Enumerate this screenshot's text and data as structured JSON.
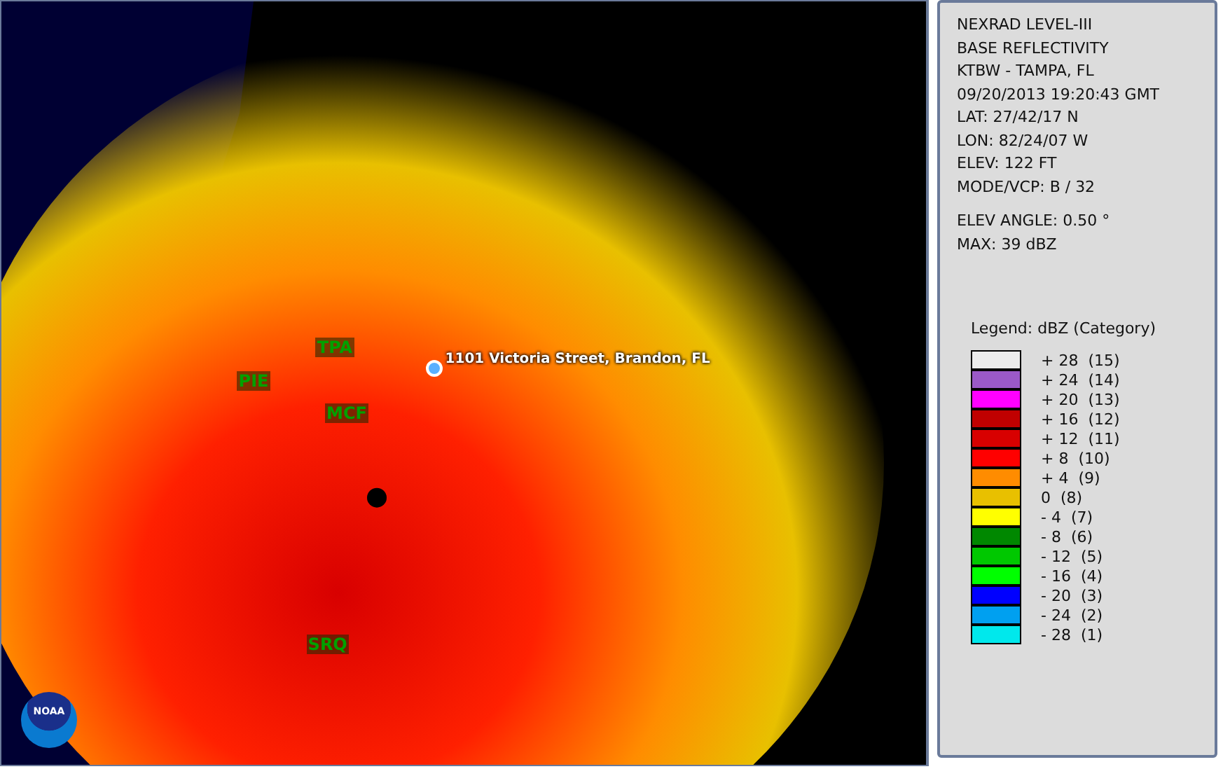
{
  "map": {
    "logo_text": "NOAA",
    "labels": [
      {
        "kind": "station",
        "text": "TPA"
      },
      {
        "kind": "station",
        "text": "PIE"
      },
      {
        "kind": "station",
        "text": "MCF"
      },
      {
        "kind": "station",
        "text": "SRQ"
      },
      {
        "kind": "address",
        "text": "1101 Victoria Street, Brandon, FL"
      }
    ]
  },
  "info": {
    "lines": [
      "NEXRAD LEVEL-III",
      "BASE REFLECTIVITY",
      "KTBW - TAMPA, FL",
      "09/20/2013 19:20:43 GMT",
      "LAT: 27/42/17 N",
      "LON: 82/24/07 W",
      "ELEV: 122 FT",
      "MODE/VCP: B / 32"
    ],
    "extra_lines": [
      "ELEV ANGLE: 0.50 °",
      "MAX: 39 dBZ"
    ]
  },
  "legend": {
    "title": "Legend: dBZ (Category)",
    "items": [
      {
        "label": "+ 28  (15)",
        "color": "#ececec"
      },
      {
        "label": "+ 24  (14)",
        "color": "#9b59c8"
      },
      {
        "label": "+ 20  (13)",
        "color": "#ff00ff"
      },
      {
        "label": "+ 16  (12)",
        "color": "#c00000"
      },
      {
        "label": "+ 12  (11)",
        "color": "#d80000"
      },
      {
        "label": "+ 8  (10)",
        "color": "#ff0000"
      },
      {
        "label": "+ 4  (9)",
        "color": "#ff8c00"
      },
      {
        "label": "0  (8)",
        "color": "#e8c000"
      },
      {
        "label": "- 4  (7)",
        "color": "#ffff00"
      },
      {
        "label": "- 8  (6)",
        "color": "#008800"
      },
      {
        "label": "- 12  (5)",
        "color": "#00c800"
      },
      {
        "label": "- 16  (4)",
        "color": "#00ff00"
      },
      {
        "label": "- 20  (3)",
        "color": "#0000ff"
      },
      {
        "label": "- 24  (2)",
        "color": "#00a0f0"
      },
      {
        "label": "- 28  (1)",
        "color": "#00e8ec"
      }
    ]
  }
}
